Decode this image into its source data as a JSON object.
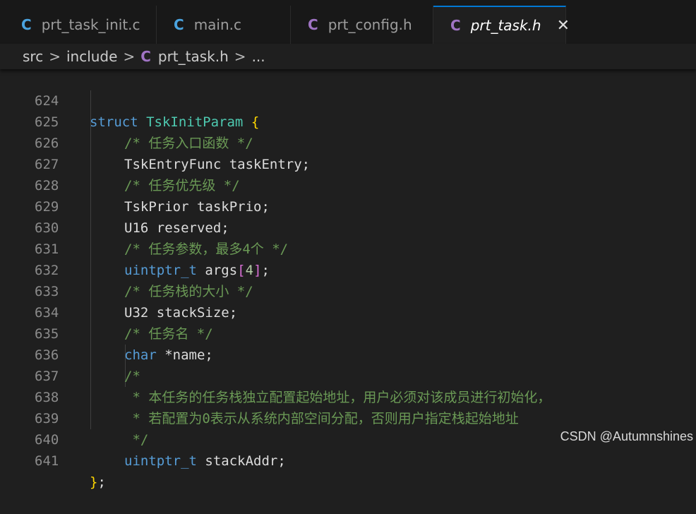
{
  "tabs": [
    {
      "icon": "C",
      "label": "prt_task_init.c",
      "active": false
    },
    {
      "icon": "C",
      "label": "main.c",
      "active": false
    },
    {
      "icon": "C",
      "label": "prt_config.h",
      "active": false
    },
    {
      "icon": "C",
      "label": "prt_task.h",
      "active": true,
      "close": "✕"
    }
  ],
  "breadcrumb": {
    "parts": [
      "src",
      "include"
    ],
    "file_icon": "C",
    "file": "prt_task.h",
    "ellipsis": "...",
    "sep": ">"
  },
  "code": {
    "line_numbers": [
      "624",
      "625",
      "626",
      "627",
      "628",
      "629",
      "630",
      "631",
      "632",
      "633",
      "634",
      "635",
      "636",
      "637",
      "638",
      "639",
      "640",
      "641"
    ],
    "struct_kw": "struct",
    "struct_name": "TskInitParam",
    "open_brace": "{",
    "close_brace": "}",
    "semicolon": ";",
    "c625": "/* 任务入口函数 */",
    "c627": "/* 任务优先级 */",
    "c630": "/* 任务参数，最多4个 */",
    "c632": "/* 任务栈的大小 */",
    "c634": "/* 任务名 */",
    "c636": "/*",
    "c637": " * 本任务的任务栈独立配置起始地址，用户必须对该成员进行初始化，",
    "c638": " * 若配置为0表示从系统内部空间分配，否则用户指定栈起始地址",
    "c639": " */",
    "l626_type": "TskEntryFunc",
    "l626_name": " taskEntry;",
    "l628_type": "TskPrior",
    "l628_name": " taskPrio;",
    "l629_type": "U16",
    "l629_name": " reserved;",
    "l631_type": "uintptr_t",
    "l631_name": " args",
    "l631_lb": "[",
    "l631_num": "4",
    "l631_rb": "]",
    "l631_end": ";",
    "l633_type": "U32",
    "l633_name": " stackSize;",
    "l635_type": "char",
    "l635_name": " *name;",
    "l640_type": "uintptr_t",
    "l640_name": " stackAddr;"
  },
  "watermark": "CSDN @Autumnshines",
  "colors": {
    "accent": "#0078d4",
    "keyword": "#569cd6",
    "comment": "#6a9955",
    "type": "#4ec9b0",
    "c_icon_blue": "#4aa3df",
    "c_icon_purple": "#a074c4"
  }
}
